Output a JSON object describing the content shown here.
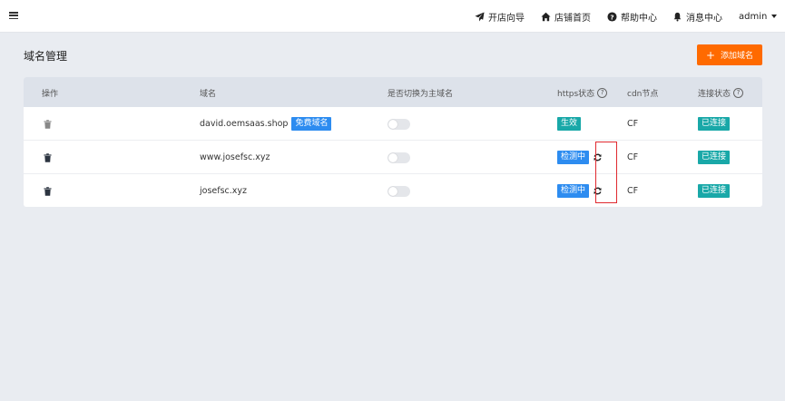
{
  "topbar": {
    "nav": [
      {
        "label": "开店向导",
        "icon": "paper-plane-icon"
      },
      {
        "label": "店铺首页",
        "icon": "home-icon"
      },
      {
        "label": "帮助中心",
        "icon": "help-circle-icon"
      },
      {
        "label": "消息中心",
        "icon": "bell-icon"
      }
    ],
    "user": "admin"
  },
  "page": {
    "title": "域名管理",
    "add_button": "添加域名",
    "add_icon": "+"
  },
  "table": {
    "headers": {
      "action": "操作",
      "domain": "域名",
      "switch_main": "是否切换为主域名",
      "https": "https状态",
      "cdn": "cdn节点",
      "connection": "连接状态"
    },
    "help_glyph": "?",
    "rows": [
      {
        "domain": "david.oemsaas.shop",
        "free_badge": "免费域名",
        "https": "生效",
        "https_color": "teal",
        "cdn": "CF",
        "connection": "已连接",
        "is_main": false
      },
      {
        "domain": "www.josefsc.xyz",
        "https": "检测中",
        "https_color": "blue",
        "cdn": "CF",
        "connection": "已连接",
        "is_main": false
      },
      {
        "domain": "josefsc.xyz",
        "https": "检测中",
        "https_color": "blue",
        "cdn": "CF",
        "connection": "已连接",
        "is_main": false
      }
    ]
  },
  "colors": {
    "accent": "#ff6a00",
    "blue_badge": "#2d8cf0",
    "teal_badge": "#19a8a8",
    "highlight": "#e0292f"
  }
}
